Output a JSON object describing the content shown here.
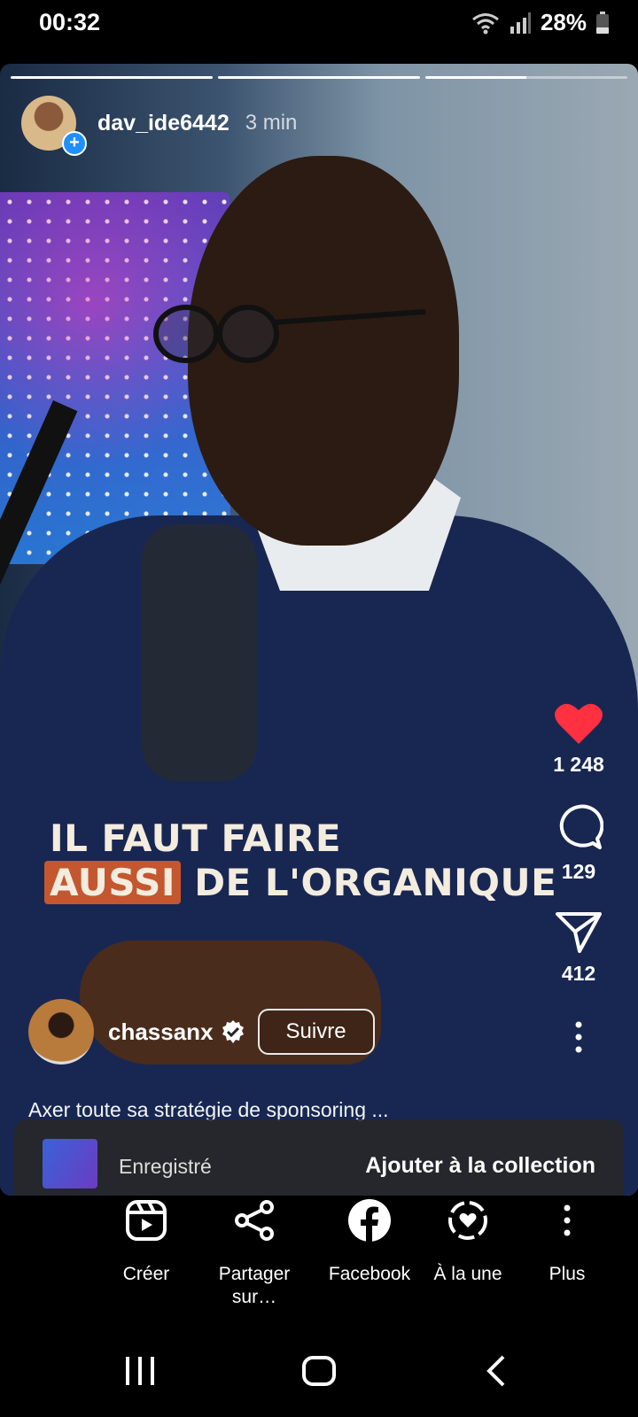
{
  "status_bar": {
    "time": "00:32",
    "battery": "28%"
  },
  "story": {
    "progress": [
      1.0,
      1.0,
      0.5
    ],
    "username": "dav_ide6442",
    "time_ago": "3 min"
  },
  "video": {
    "caption_line1": "IL FAUT FAIRE",
    "caption_highlight": "AUSSI",
    "caption_line2_rest": "DE L'ORGANIQUE"
  },
  "actions": {
    "likes": "1 248",
    "comments": "129",
    "shares": "412",
    "like_color": "#ff3040"
  },
  "author": {
    "name": "chassanx",
    "follow_label": "Suivre",
    "description": "Axer toute sa stratégie de sponsoring ..."
  },
  "saved_sheet": {
    "label": "Enregistré",
    "add_label": "Ajouter à la collection"
  },
  "share_sheet": {
    "items": [
      {
        "label": "Créer",
        "icon": "reels-icon"
      },
      {
        "label": "Partager sur…",
        "icon": "share-icon"
      },
      {
        "label": "Facebook",
        "icon": "facebook-icon"
      },
      {
        "label": "À la une",
        "icon": "highlight-icon"
      },
      {
        "label": "Plus",
        "icon": "more-vertical-icon"
      }
    ]
  }
}
